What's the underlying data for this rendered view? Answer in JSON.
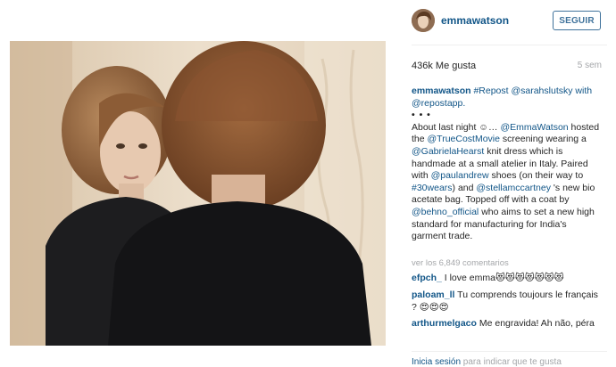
{
  "post": {
    "username": "emmawatson",
    "follow_label": "SEGUIR",
    "likes": "436k Me gusta",
    "time": "5 sem",
    "caption": {
      "author": "emmawatson",
      "line1": " #Repost @sarahslutsky with @repostapp.",
      "dots": "• • •",
      "parts": [
        {
          "t": "About last night ☺… ",
          "k": "text"
        },
        {
          "t": "@EmmaWatson",
          "k": "link"
        },
        {
          "t": " hosted the ",
          "k": "text"
        },
        {
          "t": "@TrueCostMovie",
          "k": "link"
        },
        {
          "t": " screening wearing a ",
          "k": "text"
        },
        {
          "t": "@GabrielaHearst",
          "k": "link"
        },
        {
          "t": " knit dress which is handmade at a small atelier in Italy. Paired with ",
          "k": "text"
        },
        {
          "t": "@paulandrew",
          "k": "link"
        },
        {
          "t": " shoes (on their way to ",
          "k": "text"
        },
        {
          "t": "#30wears",
          "k": "link"
        },
        {
          "t": ") and ",
          "k": "text"
        },
        {
          "t": "@stellamccartney",
          "k": "link"
        },
        {
          "t": " 's new bio acetate bag. Topped off with a coat by ",
          "k": "text"
        },
        {
          "t": "@behno_official",
          "k": "link"
        },
        {
          "t": " who aims to set a new high standard for manufacturing for India's garment trade.",
          "k": "text"
        }
      ]
    },
    "view_comments": "ver los 6,849 comentarios",
    "comments": [
      {
        "user": "efpch_",
        "text": " I love emma😻😻😻😻😻😻😻"
      },
      {
        "user": "paloam_ll",
        "text": " Tu comprends toujours le français ? 😍😍😍"
      },
      {
        "user": "arthurmelgaco",
        "text": " Me engravida! Ah não, péra"
      }
    ],
    "footer": {
      "login": "Inicia sesión",
      "rest": " para indicar que te gusta"
    }
  }
}
